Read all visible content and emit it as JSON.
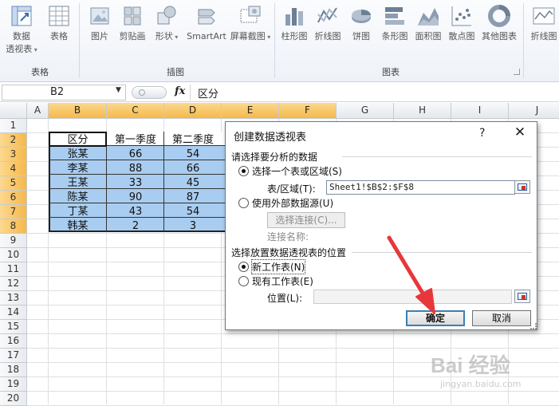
{
  "ribbon": {
    "buttons": [
      {
        "label": "数据",
        "label2": "透视表",
        "icon": "pivot-table-icon"
      },
      {
        "label": "表格",
        "icon": "table-icon"
      },
      {
        "label": "图片",
        "icon": "picture-icon"
      },
      {
        "label": "剪贴画",
        "icon": "clip-art-icon"
      },
      {
        "label": "形状",
        "icon": "shapes-icon"
      },
      {
        "label": "SmartArt",
        "icon": "smartart-icon"
      },
      {
        "label": "屏幕截图",
        "icon": "screenshot-icon"
      },
      {
        "label": "柱形图",
        "icon": "column-chart-icon"
      },
      {
        "label": "折线图",
        "icon": "line-chart-icon"
      },
      {
        "label": "饼图",
        "icon": "pie-chart-icon"
      },
      {
        "label": "条形图",
        "icon": "bar-chart-icon"
      },
      {
        "label": "面积图",
        "icon": "area-chart-icon"
      },
      {
        "label": "散点图",
        "icon": "scatter-chart-icon"
      },
      {
        "label": "其他图表",
        "icon": "other-charts-icon"
      },
      {
        "label": "折线图",
        "icon": "sparkline-line-icon"
      }
    ],
    "groups": {
      "tables": "表格",
      "illustrations": "插图",
      "charts": "图表"
    }
  },
  "formula_bar": {
    "name_box": "B2",
    "fx": "fx",
    "content": "区分"
  },
  "columns": [
    "A",
    "B",
    "C",
    "D",
    "E",
    "F",
    "G",
    "H",
    "I",
    "J"
  ],
  "rows": [
    "1",
    "2",
    "3",
    "4",
    "5",
    "6",
    "7",
    "8",
    "9",
    "10",
    "11",
    "12",
    "13",
    "14",
    "15",
    "16",
    "17",
    "18",
    "19",
    "20"
  ],
  "sheet": {
    "header": [
      "区分",
      "第一季度",
      "第二季度"
    ],
    "data": [
      [
        "张某",
        "66",
        "54"
      ],
      [
        "李某",
        "88",
        "66"
      ],
      [
        "王某",
        "33",
        "45"
      ],
      [
        "陈某",
        "90",
        "87"
      ],
      [
        "丁某",
        "43",
        "54"
      ],
      [
        "韩某",
        "2",
        "3"
      ]
    ]
  },
  "dialog": {
    "title": "创建数据透视表",
    "help": "?",
    "close": "✕",
    "section1": "请选择要分析的数据",
    "opt_select_range": "选择一个表或区域(S)",
    "range_label": "表/区域(T):",
    "range_value": "Sheet1!$B$2:$F$8",
    "opt_external": "使用外部数据源(U)",
    "choose_connection": "选择连接(C)...",
    "connection_name": "连接名称:",
    "section2": "选择放置数据透视表的位置",
    "opt_new_sheet": "新工作表(N)",
    "opt_existing_sheet": "现有工作表(E)",
    "location_label": "位置(L):",
    "location_value": "",
    "ok": "确定",
    "cancel": "取消"
  },
  "watermark": {
    "line1": "Bai 经验",
    "line2": "jingyan.baidu.com"
  },
  "colors": {
    "selection": "#a9cdf0",
    "header_highlight": "#f5b94a",
    "arrow": "#e8373a"
  }
}
